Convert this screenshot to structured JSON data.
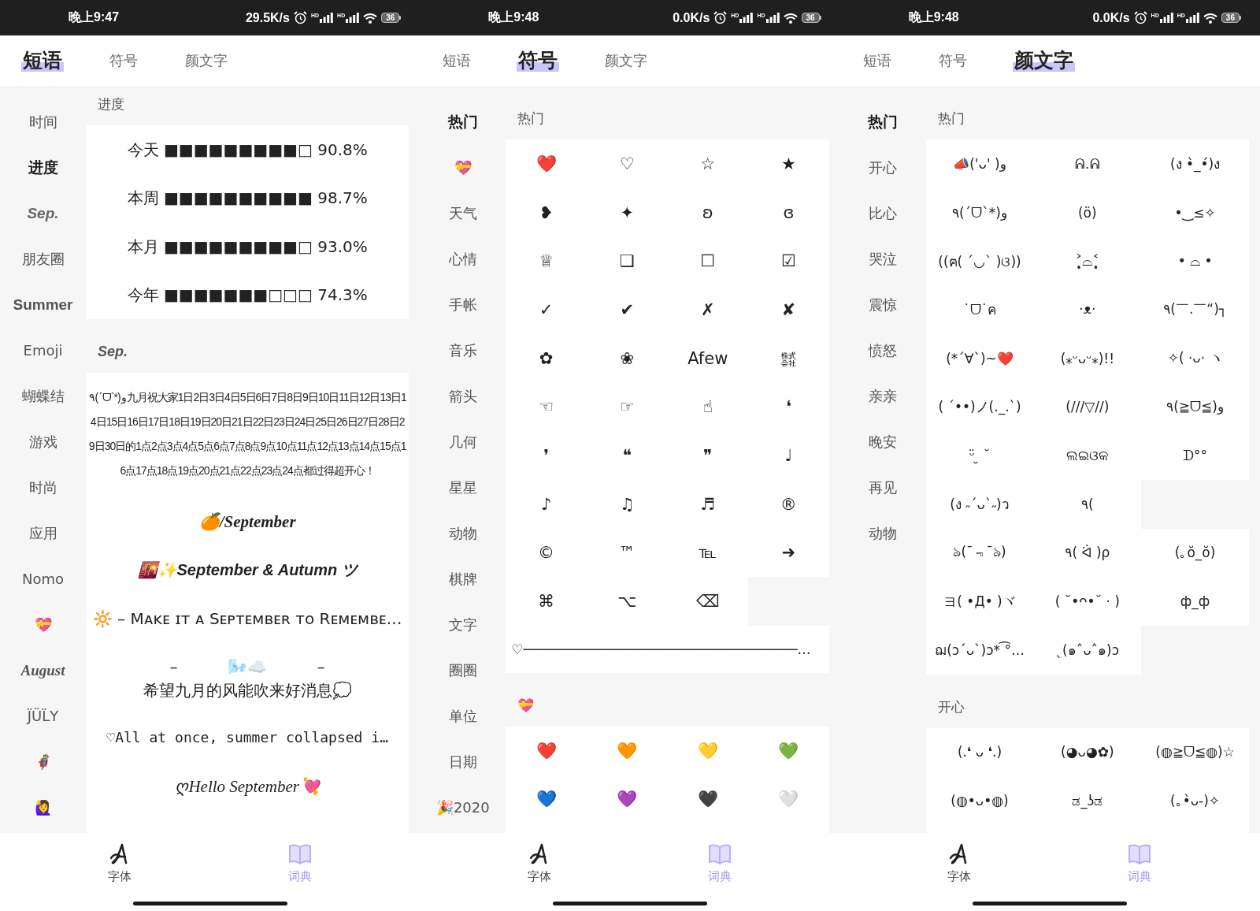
{
  "screens": [
    {
      "status_bar": {
        "time": "晚上9:47",
        "speed": "29.5K/s",
        "network": [
          "HD",
          "HD"
        ],
        "battery": "36"
      },
      "tabs": [
        {
          "label": "短语",
          "selected": true
        },
        {
          "label": "符号",
          "selected": false
        },
        {
          "label": "颜文字",
          "selected": false
        }
      ],
      "sidebar": [
        {
          "label": "时间",
          "kind": "plain",
          "selected": false
        },
        {
          "label": "进度",
          "kind": "plain",
          "selected": true
        },
        {
          "label": "Sep.",
          "kind": "italic",
          "selected": false
        },
        {
          "label": "朋友圈",
          "kind": "plain",
          "selected": false
        },
        {
          "label": "Summer",
          "kind": "bold",
          "selected": false
        },
        {
          "label": "Emoji",
          "kind": "plain",
          "selected": false
        },
        {
          "label": "蝴蝶结",
          "kind": "plain",
          "selected": false
        },
        {
          "label": "游戏",
          "kind": "plain",
          "selected": false
        },
        {
          "label": "时尚",
          "kind": "plain",
          "selected": false
        },
        {
          "label": "应用",
          "kind": "plain",
          "selected": false
        },
        {
          "label": "Nomo",
          "kind": "plain",
          "selected": false
        },
        {
          "label": "💝",
          "kind": "plain",
          "selected": false
        },
        {
          "label": "August",
          "kind": "serif",
          "selected": false
        },
        {
          "label": "J̈ÜL̈Y",
          "kind": "plain",
          "selected": false
        },
        {
          "label": "🦸",
          "kind": "plain",
          "selected": false
        },
        {
          "label": "🙋‍♀️",
          "kind": "plain",
          "selected": false
        }
      ],
      "sections": [
        {
          "heading": {
            "text": "进度",
            "kind": "plain"
          },
          "kind": "phrases",
          "items": [
            {
              "text": "今天 ■■■■■■■■■□ 90.8%",
              "kind": "plain"
            },
            {
              "text": "本周 ■■■■■■■■■■ 98.7%",
              "kind": "plain"
            },
            {
              "text": "本月 ■■■■■■■■■□ 93.0%",
              "kind": "plain"
            },
            {
              "text": "今年 ■■■■■■■□□□ 74.3%",
              "kind": "plain"
            }
          ]
        },
        {
          "heading": {
            "text": "Sep.",
            "kind": "italic"
          },
          "kind": "phrases",
          "items": [
            {
              "text": "٩(ˊᗜˋ*)و九月祝大家1日2日3日4日5日6日7日8日9日10日11日12日13日14日15日16日17日18日19日20日21日22日23日24日25日26日27日28日29日30日的1点2点3点4点5点6点7点8点9点10点11点12点13点14点15点16点17点18点19点20点21点22点23点24点都过得超开心！",
              "kind": "dense"
            },
            {
              "text": "🍊/September",
              "kind": "script"
            },
            {
              "text": "🌇✨September & Autumn ツ",
              "kind": "italic"
            },
            {
              "text": "🔆 – Mᴀᴋᴇ ɪᴛ ᴀ Sᴇᴘᴛᴇᴍʙᴇʀ ᴛᴏ Rᴇᴍᴇᴍʙᴇ…",
              "kind": "plain"
            },
            {
              "text": "–          🌬️☁️          –\n希望九月的风能吹来好消息💭",
              "kind": "plain"
            },
            {
              "text": "♡All at once, summer collapsed i…",
              "kind": "mono"
            },
            {
              "text": "ღHello September💘",
              "kind": "serif"
            }
          ]
        }
      ],
      "bottom_nav": [
        {
          "label": "字体",
          "kind": "font",
          "selected": false
        },
        {
          "label": "词典",
          "kind": "dictionary",
          "selected": true
        }
      ]
    },
    {
      "status_bar": {
        "time": "晚上9:48",
        "speed": "0.0K/s",
        "network": [
          "HD",
          "HD"
        ],
        "battery": "36"
      },
      "tabs": [
        {
          "label": "短语",
          "selected": false
        },
        {
          "label": "符号",
          "selected": true
        },
        {
          "label": "颜文字",
          "selected": false
        }
      ],
      "sidebar": [
        {
          "label": "热门",
          "kind": "plain",
          "selected": true
        },
        {
          "label": "💝",
          "kind": "plain",
          "selected": false
        },
        {
          "label": "天气",
          "kind": "plain",
          "selected": false
        },
        {
          "label": "心情",
          "kind": "plain",
          "selected": false
        },
        {
          "label": "手帐",
          "kind": "plain",
          "selected": false
        },
        {
          "label": "音乐",
          "kind": "plain",
          "selected": false
        },
        {
          "label": "箭头",
          "kind": "plain",
          "selected": false
        },
        {
          "label": "几何",
          "kind": "plain",
          "selected": false
        },
        {
          "label": "星星",
          "kind": "plain",
          "selected": false
        },
        {
          "label": "动物",
          "kind": "plain",
          "selected": false
        },
        {
          "label": "棋牌",
          "kind": "plain",
          "selected": false
        },
        {
          "label": "文字",
          "kind": "plain",
          "selected": false
        },
        {
          "label": "圈圈",
          "kind": "plain",
          "selected": false
        },
        {
          "label": "单位",
          "kind": "plain",
          "selected": false
        },
        {
          "label": "日期",
          "kind": "plain",
          "selected": false
        },
        {
          "label": "🎉2020",
          "kind": "plain",
          "selected": false
        }
      ],
      "sections": [
        {
          "heading": {
            "text": "热门",
            "kind": "plain"
          },
          "kind": "symbols",
          "rows": [
            [
              "❤️",
              "♡",
              "☆",
              "★"
            ],
            [
              "❥",
              "✦",
              "ʚ",
              "ɞ"
            ],
            [
              "♕",
              "❏",
              "☐",
              "☑"
            ],
            [
              "✓",
              "✔",
              "✗",
              "✘"
            ],
            [
              "✿",
              "❀",
              "Afew",
              "㍿"
            ],
            [
              "☜",
              "☞",
              "☝",
              "❛"
            ],
            [
              "❜",
              "❝",
              "❞",
              "♩"
            ],
            [
              "♪",
              "♫",
              "♬",
              "®"
            ],
            [
              "©",
              "™",
              "℡",
              "➜"
            ],
            [
              "⌘",
              "⌥",
              "⌫"
            ]
          ],
          "wide_row": "♡──────────────────────────────────…"
        },
        {
          "heading": {
            "text": "💝",
            "kind": "plain"
          },
          "kind": "symbols",
          "rows": [
            [
              "❤️",
              "🧡",
              "💛",
              "💚"
            ],
            [
              "💙",
              "💜",
              "🖤",
              "🤍"
            ]
          ]
        }
      ],
      "bottom_nav": [
        {
          "label": "字体",
          "kind": "font",
          "selected": false
        },
        {
          "label": "词典",
          "kind": "dictionary",
          "selected": true
        }
      ]
    },
    {
      "status_bar": {
        "time": "晚上9:48",
        "speed": "0.0K/s",
        "network": [
          "HD",
          "HD"
        ],
        "battery": "36"
      },
      "tabs": [
        {
          "label": "短语",
          "selected": false
        },
        {
          "label": "符号",
          "selected": false
        },
        {
          "label": "颜文字",
          "selected": true
        }
      ],
      "sidebar": [
        {
          "label": "热门",
          "kind": "plain",
          "selected": true
        },
        {
          "label": "开心",
          "kind": "plain",
          "selected": false
        },
        {
          "label": "比心",
          "kind": "plain",
          "selected": false
        },
        {
          "label": "哭泣",
          "kind": "plain",
          "selected": false
        },
        {
          "label": "震惊",
          "kind": "plain",
          "selected": false
        },
        {
          "label": "愤怒",
          "kind": "plain",
          "selected": false
        },
        {
          "label": "亲亲",
          "kind": "plain",
          "selected": false
        },
        {
          "label": "晚安",
          "kind": "plain",
          "selected": false
        },
        {
          "label": "再见",
          "kind": "plain",
          "selected": false
        },
        {
          "label": "动物",
          "kind": "plain",
          "selected": false
        }
      ],
      "sections": [
        {
          "heading": {
            "text": "热门",
            "kind": "plain"
          },
          "kind": "emoticons",
          "rows": [
            [
              "📣('ᴗ' )و",
              "ᕱ.ᕱ",
              "(ง •̀_•́)ง"
            ],
            [
              "٩(ˊᗜˋ*)و",
              "(ö)",
              "•‿≤✧"
            ],
            [
              "((ฅ( ´◡` )ଓ))",
              "˃̣̣̥⌓˂̣̣̥",
              "• ⌓ •"
            ],
            [
              "˙ᗜ˙ค",
              "·ᴥ·",
              "٩(￣.￣“)┐"
            ],
            [
              "(*´∀`)~❤️",
              "(⁎ᵕᴗᵕ⁎)!!",
              "✧( ·ᴗ· ヽ"
            ],
            [
              "( ´••)ノ(._.`)",
              "(///▽//)",
              "٩(≧ᗜ≦)و"
            ],
            [
              "ᵕ̈ ̮ ˘",
              "ଲଇଓକ",
              "ᗪ°°"
            ],
            [
              "(ง ˶´ᴗ`˶)ว",
              "٩("
            ],
            [
              "ঌ(¯﹃¯ঌ)",
              "٩( ᐛ )ρ",
              "(｡ŏ_ŏ)"
            ],
            [
              "ヨ( •Д• )ヾ",
              "( ˘•ᴖ•˘ · )",
              "ф_ф"
            ],
            [
              "ฌ(ɔ´ᴗ`)ɔ* ͡°…",
              "ˎ(๑ˆᴗˆ๑)ɔ"
            ]
          ]
        },
        {
          "heading": {
            "text": "开心",
            "kind": "plain"
          },
          "kind": "emoticons",
          "rows": [
            [
              "(.❛ ᴗ ❛.)",
              "(◕ᴗ◕✿)",
              "(◍≧ᗜ≦◍)☆"
            ],
            [
              "(◍•ᴗ•◍)",
              "ಡ_ʖಡ",
              "(｡•̀ᴗ-)✧"
            ]
          ]
        }
      ],
      "bottom_nav": [
        {
          "label": "字体",
          "kind": "font",
          "selected": false
        },
        {
          "label": "词典",
          "kind": "dictionary",
          "selected": true
        }
      ]
    }
  ]
}
